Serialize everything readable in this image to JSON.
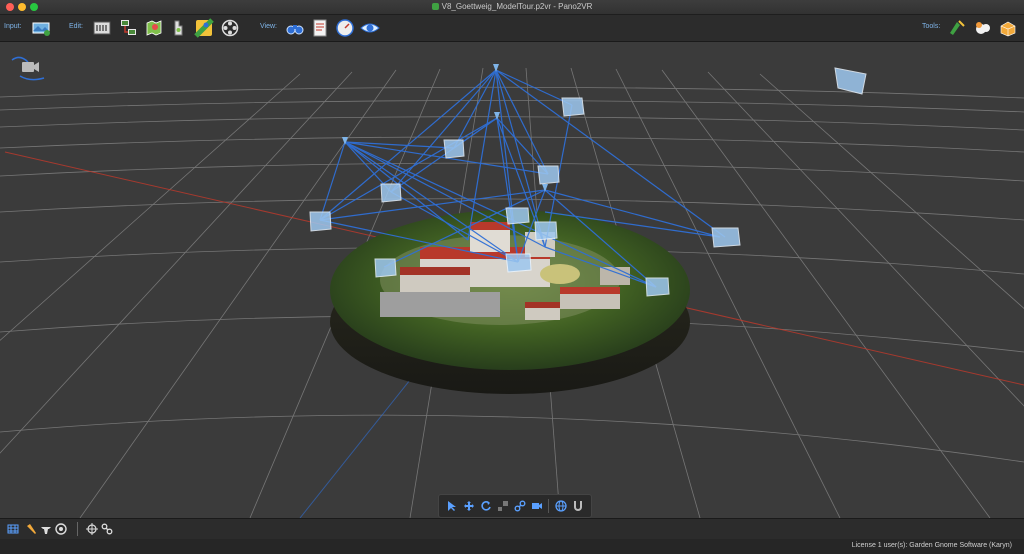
{
  "window": {
    "title": "V8_Goettweig_ModelTour.p2vr - Pano2VR"
  },
  "toolbar": {
    "input_label": "Input:",
    "edit_label": "Edit:",
    "view_label": "View:",
    "tools_label": "Tools:",
    "input_buttons": [
      {
        "icon": "import-panorama-icon"
      }
    ],
    "edit_buttons": [
      {
        "icon": "properties-editor-icon"
      },
      {
        "icon": "tour-browser-icon"
      },
      {
        "icon": "map-editor-icon"
      },
      {
        "icon": "skin-editor-icon"
      },
      {
        "icon": "tour-map-icon"
      },
      {
        "icon": "animation-editor-icon"
      }
    ],
    "view_buttons": [
      {
        "icon": "viewing-parameters-icon"
      },
      {
        "icon": "report-icon"
      },
      {
        "icon": "output-icon"
      },
      {
        "icon": "preview-eye-icon"
      }
    ],
    "tools_buttons": [
      {
        "icon": "skin-tool-icon"
      },
      {
        "icon": "cloud-publish-icon"
      },
      {
        "icon": "package-tool-icon"
      }
    ]
  },
  "viewport": {
    "background": "#3b3b3b",
    "grid_color": "#8a8a8a",
    "axis_color": "#c0392b",
    "link_color": "#2f6fd6",
    "camera_icon": "camera-nav-icon"
  },
  "view_controls": [
    {
      "icon": "select-arrow-icon"
    },
    {
      "icon": "move-icon"
    },
    {
      "icon": "rotate-icon"
    },
    {
      "icon": "scale-icon"
    },
    {
      "icon": "link-icon"
    },
    {
      "icon": "camera-icon"
    },
    {
      "icon": "globe-icon"
    },
    {
      "icon": "magnet-icon"
    }
  ],
  "bottom_bar": {
    "buttons": [
      {
        "icon": "grid-toggle-icon"
      },
      {
        "icon": "flashlight-icon"
      },
      {
        "icon": "hat-icon"
      },
      {
        "icon": "target-icon"
      },
      {
        "icon": "crosshair-icon"
      },
      {
        "icon": "chain-link-icon"
      }
    ]
  },
  "status": {
    "license": "License 1 user(s): Garden Gnome Software (Karyn)"
  }
}
